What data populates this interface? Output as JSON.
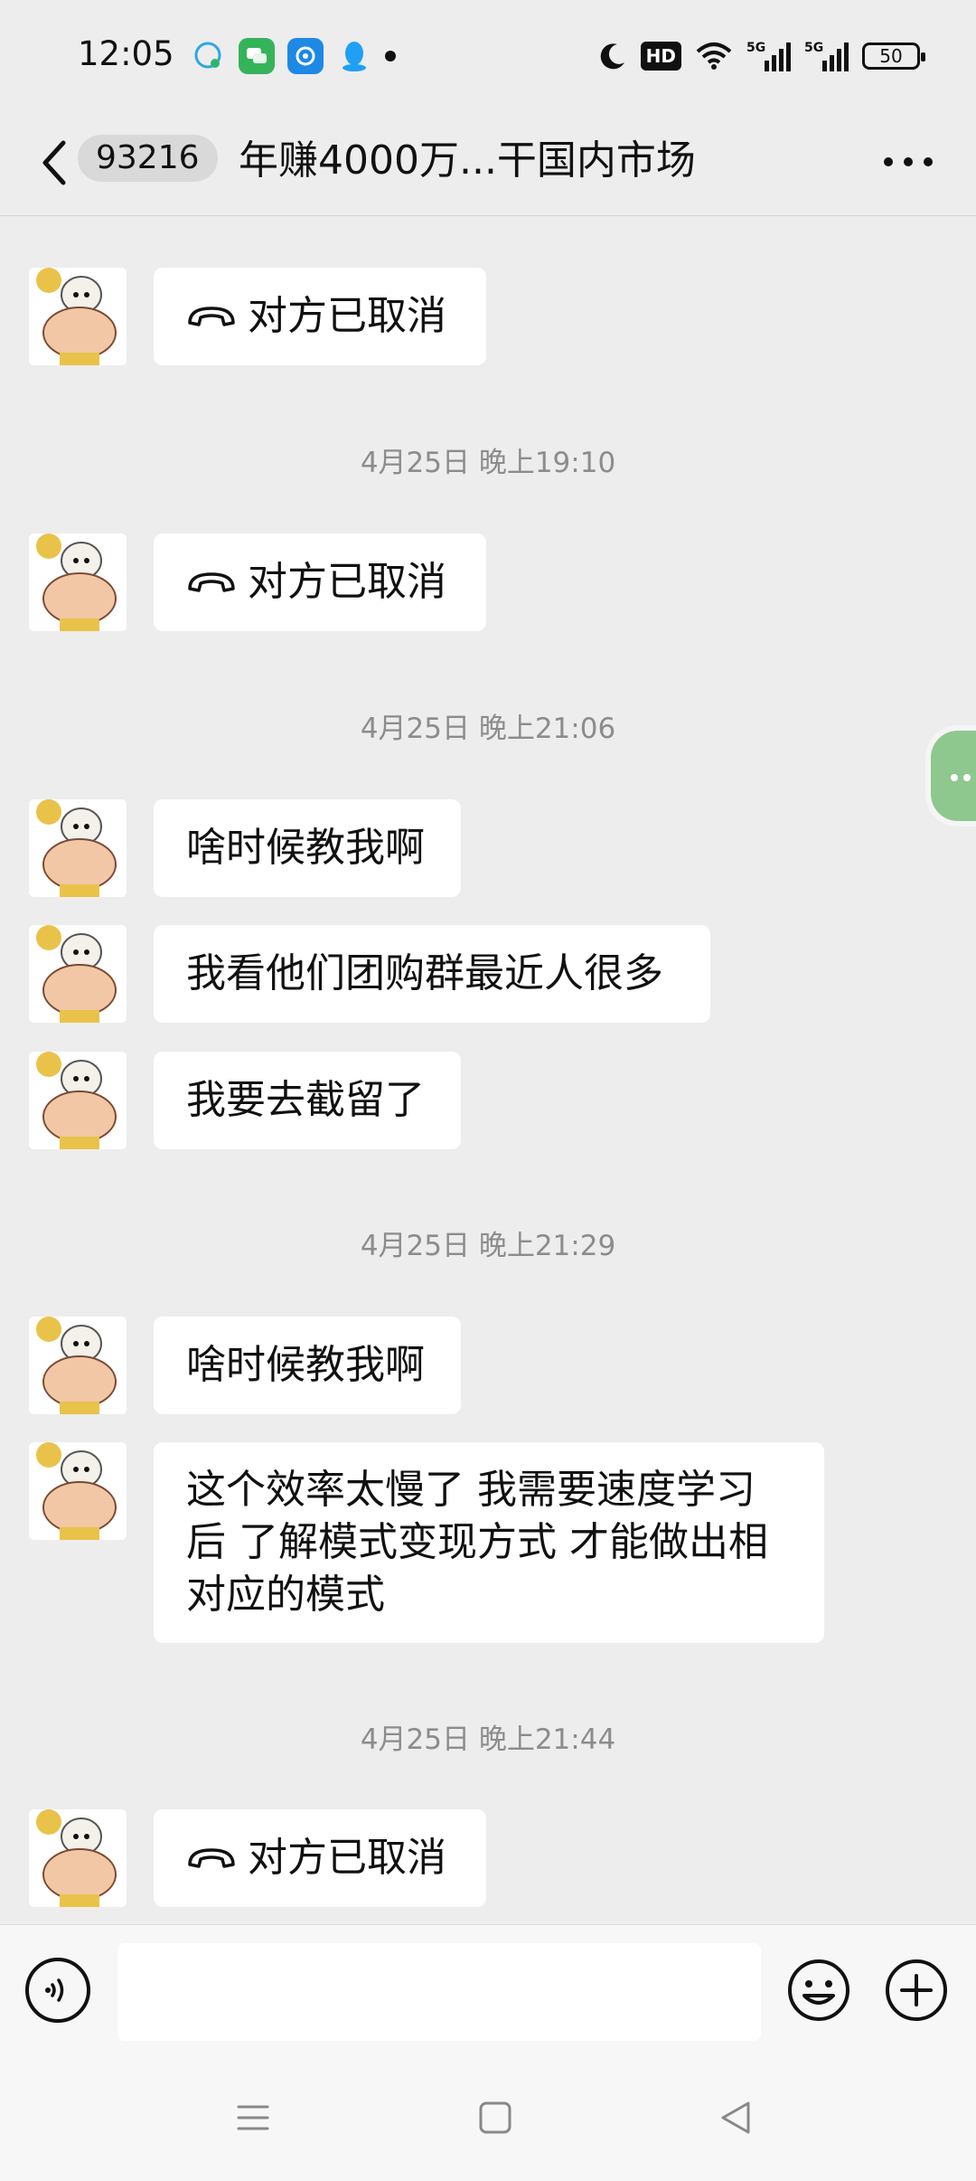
{
  "status_bar": {
    "time": "12:05",
    "battery": "50",
    "icons": [
      "message-app-icon",
      "chat-app-icon",
      "browser-app-icon",
      "qq-app-icon",
      "moon-icon",
      "hd-voice-icon",
      "wifi-icon",
      "5g-signal-icon",
      "5g-signal-icon",
      "battery-icon"
    ],
    "hd_label": "HD"
  },
  "header": {
    "unread_count": "93216",
    "title": "年赚4000万...干国内市场"
  },
  "messages": [
    {
      "type": "call",
      "text": "对方已取消"
    },
    {
      "type": "time",
      "text": "4月25日 晚上19:10"
    },
    {
      "type": "call",
      "text": "对方已取消"
    },
    {
      "type": "time",
      "text": "4月25日 晚上21:06"
    },
    {
      "type": "text",
      "text": "啥时候教我啊"
    },
    {
      "type": "text",
      "text": "我看他们团购群最近人很多"
    },
    {
      "type": "text",
      "text": "我要去截留了"
    },
    {
      "type": "time",
      "text": "4月25日 晚上21:29"
    },
    {
      "type": "text",
      "text": "啥时候教我啊"
    },
    {
      "type": "text",
      "lines": [
        "这个效率太慢了 我需要速度学习",
        "后 了解模式变现方式 才能做出相",
        "对应的模式"
      ]
    },
    {
      "type": "time",
      "text": "4月25日 晚上21:44"
    },
    {
      "type": "call",
      "text": "对方已取消"
    }
  ],
  "input_bar": {
    "placeholder": "",
    "value": ""
  },
  "colors": {
    "background": "#ededed",
    "bubble": "#ffffff",
    "timestamp": "#8c8c8c",
    "floating_button": "#8fc88f"
  }
}
